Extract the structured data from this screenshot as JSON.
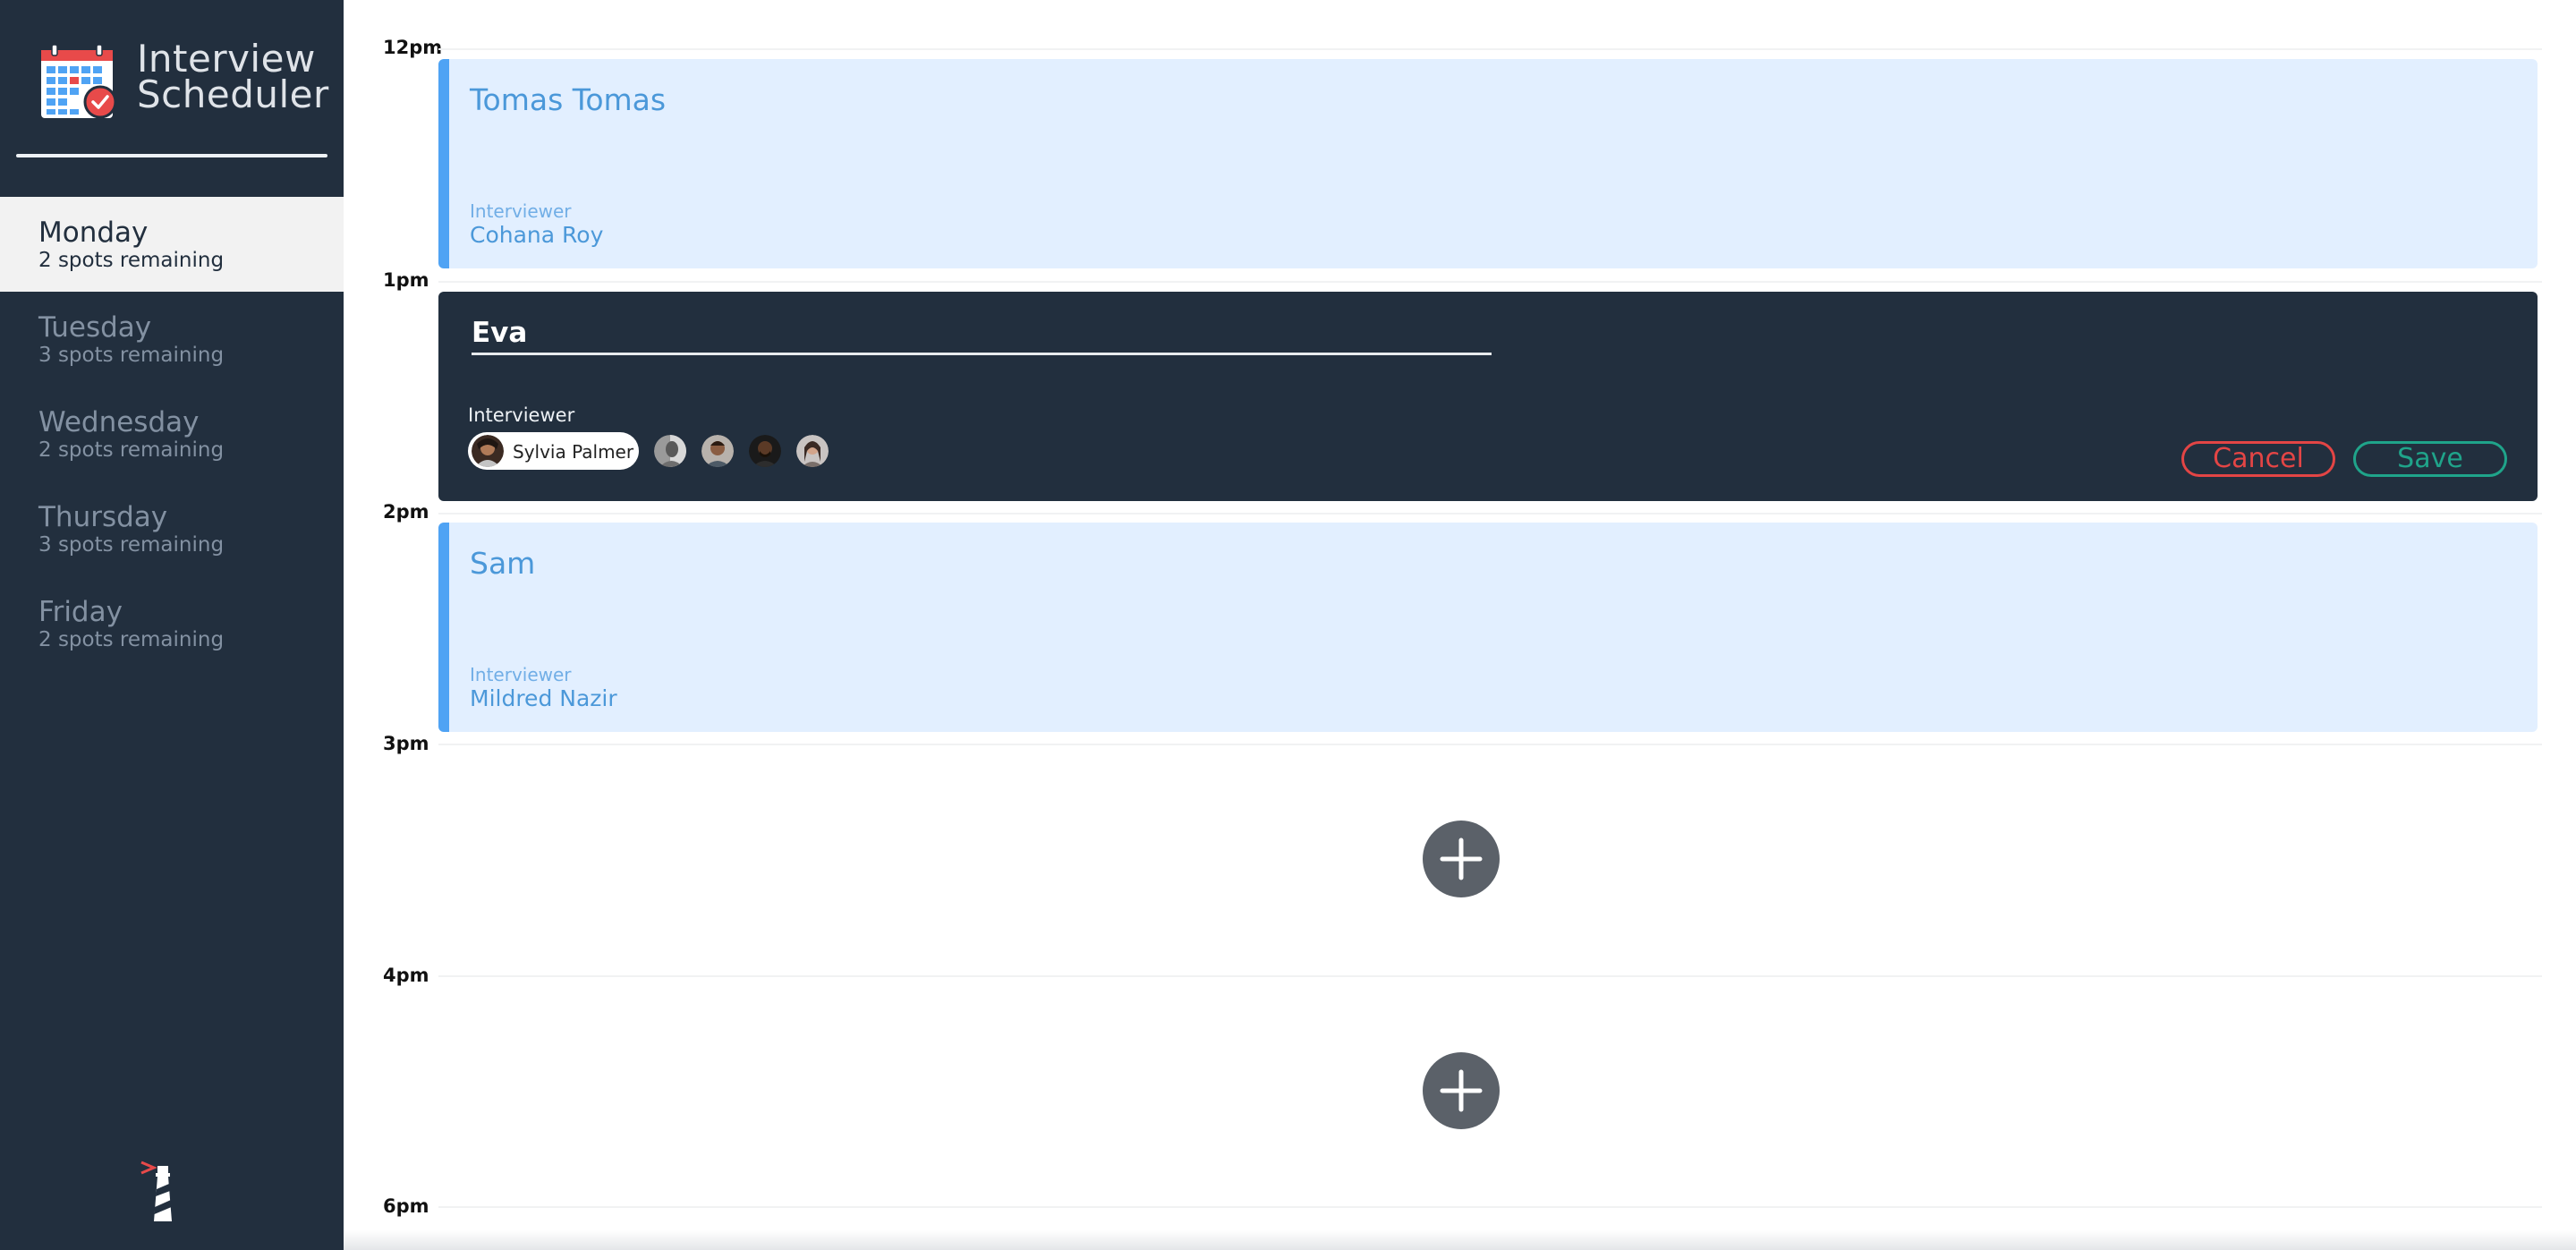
{
  "app": {
    "title_line1": "Interview",
    "title_line2": "Scheduler"
  },
  "sidebar": {
    "days": [
      {
        "name": "Monday",
        "spots": "2 spots remaining",
        "selected": true
      },
      {
        "name": "Tuesday",
        "spots": "3 spots remaining",
        "selected": false
      },
      {
        "name": "Wednesday",
        "spots": "2 spots remaining",
        "selected": false
      },
      {
        "name": "Thursday",
        "spots": "3 spots remaining",
        "selected": false
      },
      {
        "name": "Friday",
        "spots": "2 spots remaining",
        "selected": false
      }
    ]
  },
  "schedule": {
    "times": [
      "12pm",
      "1pm",
      "2pm",
      "3pm",
      "4pm",
      "6pm"
    ],
    "appointments": [
      {
        "student": "Tomas Tomas",
        "interviewer_label": "Interviewer",
        "interviewer": "Cohana Roy"
      },
      {
        "student": "Sam",
        "interviewer_label": "Interviewer",
        "interviewer": "Mildred Nazir"
      }
    ],
    "form": {
      "student_value": "Eva",
      "interviewer_label": "Interviewer",
      "selected_interviewer": "Sylvia Palmer",
      "cancel_label": "Cancel",
      "save_label": "Save"
    }
  },
  "colors": {
    "sidebar_bg": "#222f3e",
    "appointment_bg": "#e2efff",
    "appointment_accent": "#4fa3f4",
    "cancel": "#e34545",
    "save": "#1fa48a",
    "add_button": "#5b6169"
  },
  "icons": {
    "brand": "calendar-check-icon",
    "footer": "lighthouse-logo-icon",
    "add": "plus-icon"
  }
}
